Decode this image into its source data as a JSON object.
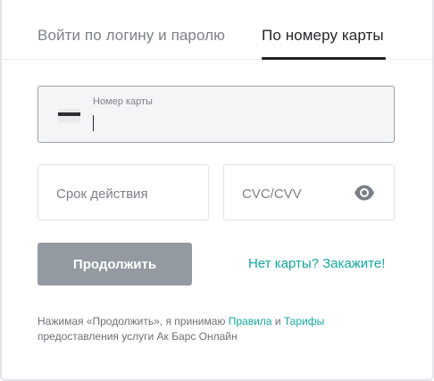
{
  "tabs": {
    "login": "Войти по логину и паролю",
    "card": "По номеру карты",
    "active": "card"
  },
  "card_number": {
    "label": "Номер карты",
    "value": ""
  },
  "expiry": {
    "placeholder": "Срок действия",
    "value": ""
  },
  "cvc": {
    "placeholder": "CVC/CVV",
    "value": ""
  },
  "actions": {
    "continue_label": "Продолжить",
    "order_card_link": "Нет карты? Закажите!"
  },
  "legal": {
    "prefix": "Нажимая «Продолжить», я принимаю ",
    "rules_link": "Правила",
    "and": " и ",
    "tariffs_link": "Тарифы",
    "suffix": "предоставления услуги Ак Барс Онлайн"
  },
  "colors": {
    "accent": "#13a89e",
    "button_disabled": "#939aa1",
    "text_primary": "#23262a",
    "text_secondary": "#7c8187"
  },
  "icons": {
    "card": "card-icon",
    "eye": "eye-icon"
  }
}
